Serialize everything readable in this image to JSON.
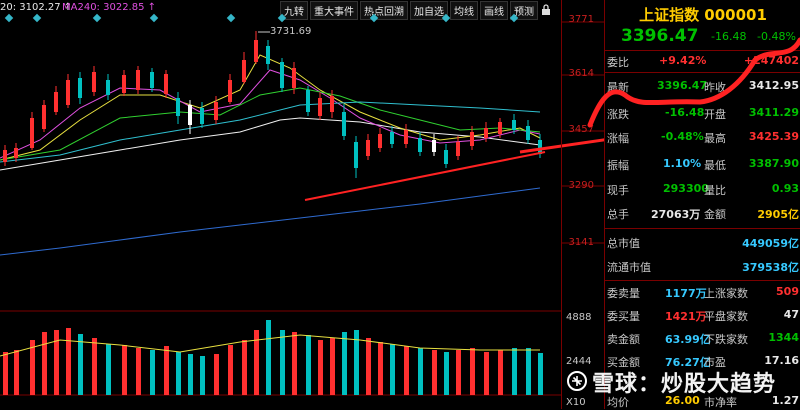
{
  "chart_header": {
    "ma20": "20: 3102.27 ↑",
    "ma240": "MA240: 3022.85 ↑"
  },
  "toolbar": {
    "items": [
      "九转",
      "重大事件",
      "热点回溯",
      "加自选",
      "均线",
      "画线",
      "预测"
    ]
  },
  "price_axis": {
    "ticks": [
      "3771",
      "3614",
      "3457",
      "3290",
      "3141"
    ]
  },
  "volume_axis": {
    "ticks": [
      "4888",
      "2444",
      "X10"
    ]
  },
  "peak_label": "3731.69",
  "colors": {
    "up": "#ff3030",
    "down": "#00c000",
    "annotation": "#ff2222",
    "title": "#ffcc00"
  },
  "quote": {
    "title": "上证指数 000001",
    "last": "3396.47",
    "change": "-16.48",
    "change_pct": "-0.48%",
    "rows": [
      {
        "l1": "委比",
        "v1": "+9.42%",
        "l2": "",
        "v2": "+247402"
      },
      {
        "l1": "最新",
        "v1": "3396.47",
        "l2": "昨收",
        "v2": "3412.95"
      },
      {
        "l1": "涨跌",
        "v1": "-16.48",
        "l2": "开盘",
        "v2": "3411.29"
      },
      {
        "l1": "涨幅",
        "v1": "-0.48%",
        "l2": "最高",
        "v2": "3425.39"
      },
      {
        "l1": "振幅",
        "v1": "1.10%",
        "l2": "最低",
        "v2": "3387.90"
      },
      {
        "l1": "现手",
        "v1": "293300",
        "l2": "量比",
        "v2": "0.93"
      },
      {
        "l1": "总手",
        "v1": "27063万",
        "l2": "金额",
        "v2": "2905亿"
      }
    ],
    "cap": [
      {
        "label": "总市值",
        "value": "449059亿"
      },
      {
        "label": "流通市值",
        "value": "379538亿"
      }
    ],
    "stats": [
      {
        "l1": "委卖量",
        "v1": "1177万",
        "l2": "上涨家数",
        "v2": "509"
      },
      {
        "l1": "委买量",
        "v1": "1421万",
        "l2": "平盘家数",
        "v2": "47"
      },
      {
        "l1": "卖金额",
        "v1": "63.99亿",
        "l2": "下跌家数",
        "v2": "1344"
      },
      {
        "l1": "买金额",
        "v1": "76.27亿",
        "l2": "市盈",
        "v2": "17.16"
      },
      {
        "l1": "均价",
        "v1": "26.00",
        "l2": "市净率",
        "v2": "1.27"
      }
    ]
  },
  "watermark": "雪球：炒股大趋势"
}
